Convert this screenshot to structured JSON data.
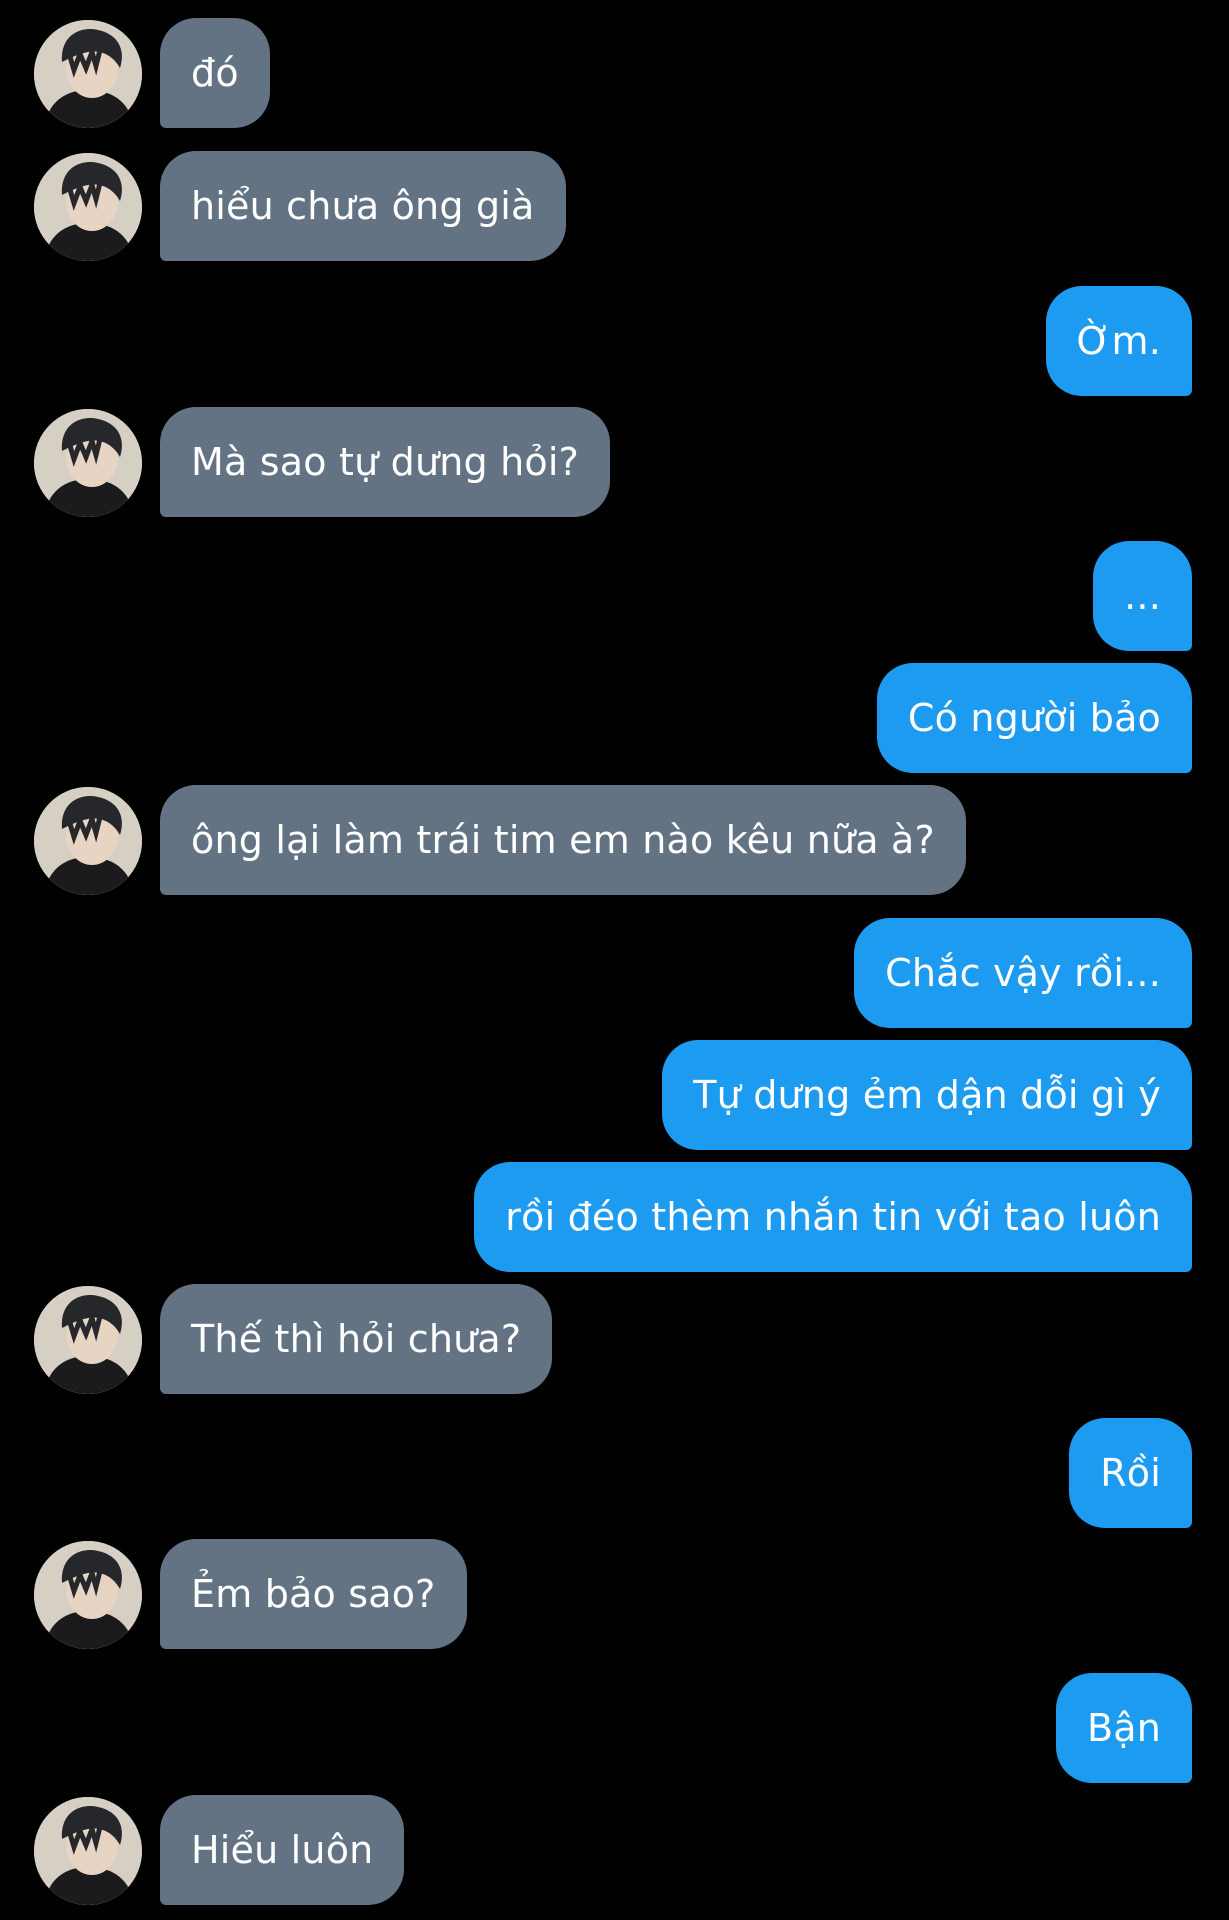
{
  "conversation": {
    "messages": [
      {
        "side": "incoming",
        "text": "đó"
      },
      {
        "side": "incoming",
        "text": "hiểu chưa ông già"
      },
      {
        "side": "outgoing",
        "text": "Ờm."
      },
      {
        "side": "incoming",
        "text": "Mà sao tự dưng hỏi?"
      },
      {
        "side": "outgoing",
        "text": "..."
      },
      {
        "side": "outgoing",
        "text": "Có người bảo"
      },
      {
        "side": "incoming",
        "text": "ông lại làm trái tim em nào kêu nữa à?"
      },
      {
        "side": "outgoing",
        "text": "Chắc vậy rồi..."
      },
      {
        "side": "outgoing",
        "text": "Tự dưng ẻm dận dỗi gì ý"
      },
      {
        "side": "outgoing",
        "text": "rồi đéo thèm nhắn tin với tao luôn"
      },
      {
        "side": "incoming",
        "text": "Thế thì hỏi chưa?"
      },
      {
        "side": "outgoing",
        "text": "Rồi"
      },
      {
        "side": "incoming",
        "text": "Ẻm bảo sao?"
      },
      {
        "side": "outgoing",
        "text": "Bận"
      },
      {
        "side": "incoming",
        "text": "Hiểu luôn"
      }
    ]
  },
  "avatar_icon": "user-photo-avatar",
  "colors": {
    "background": "#000000",
    "incoming_bubble": "#647384",
    "outgoing_bubble": "#1d9bf0",
    "text": "#ffffff"
  }
}
